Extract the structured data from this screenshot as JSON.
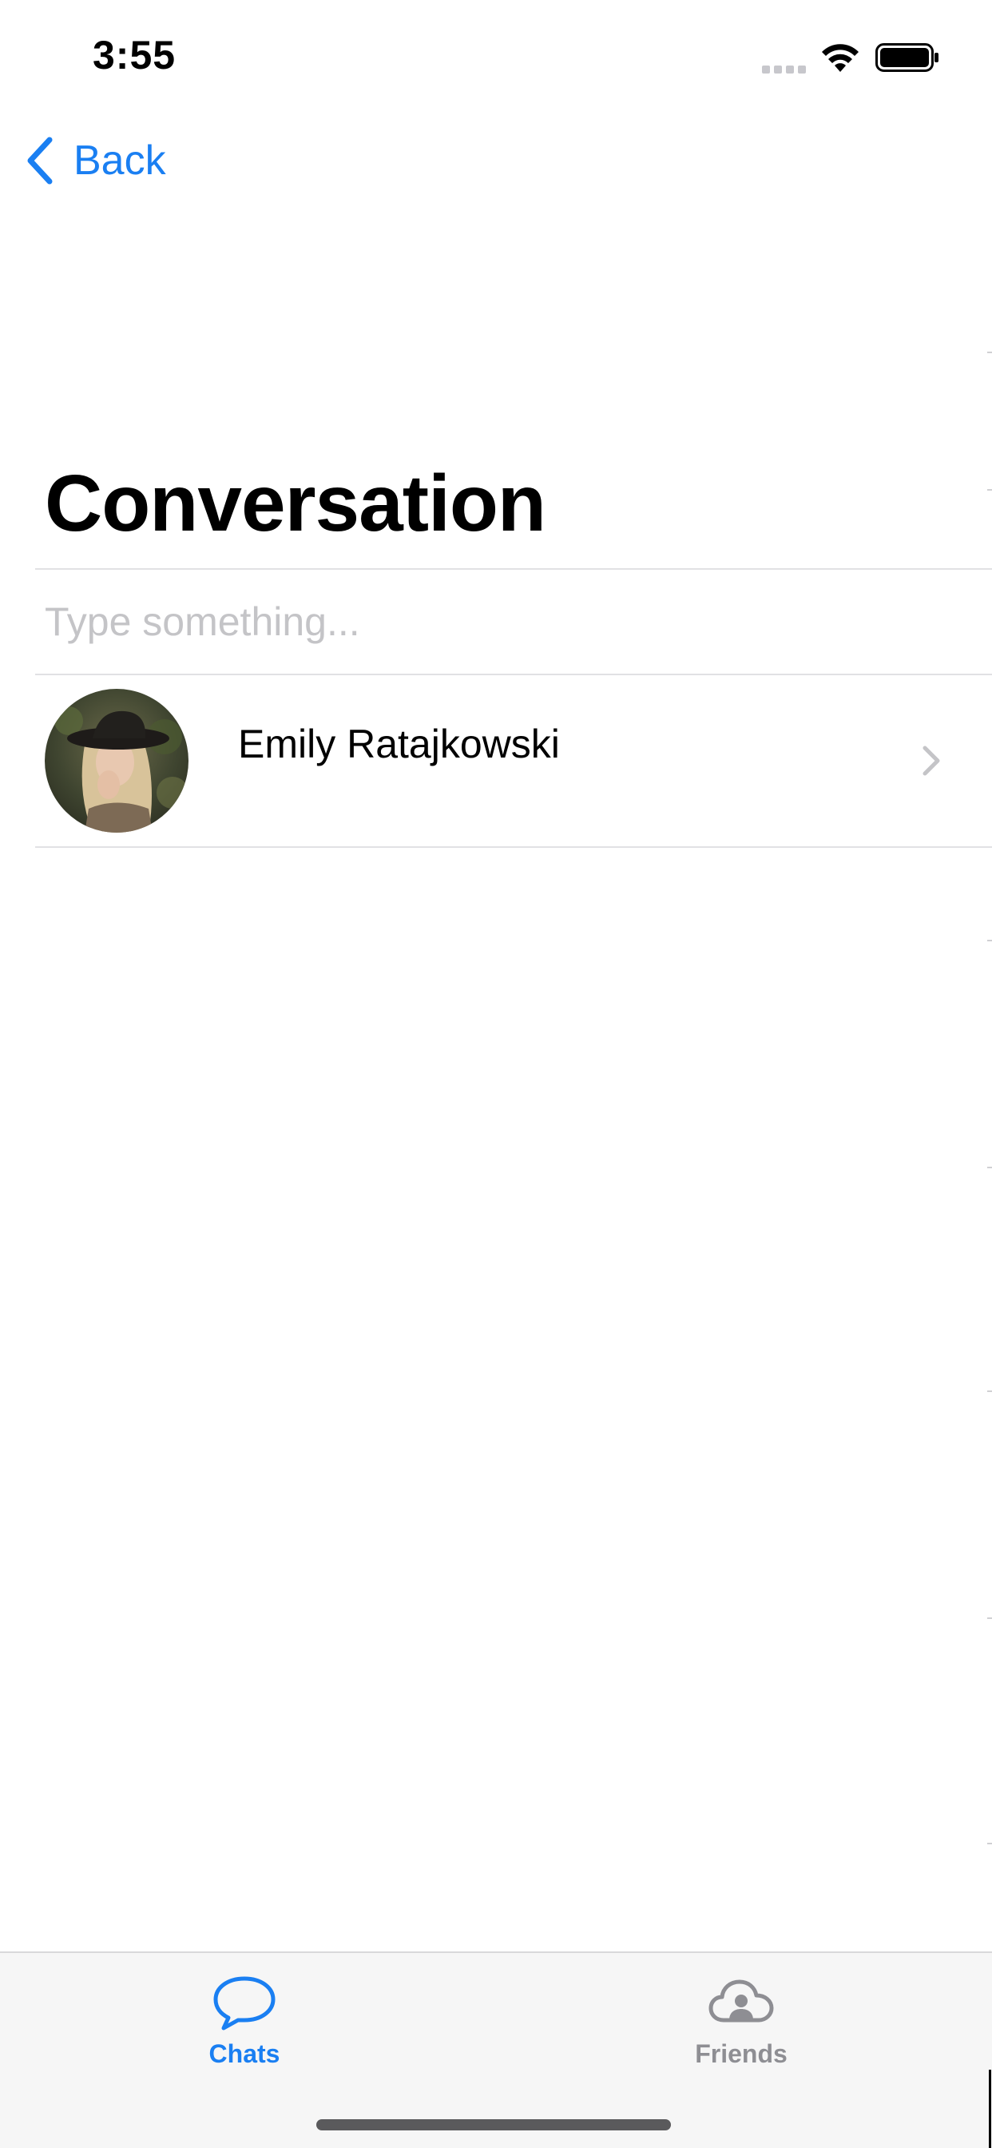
{
  "status_bar": {
    "time": "3:55"
  },
  "nav": {
    "back_label": "Back"
  },
  "page": {
    "title": "Conversation"
  },
  "search": {
    "placeholder": "Type something...",
    "value": ""
  },
  "conversations": [
    {
      "name": "Emily Ratajkowski",
      "avatar": "photo-avatar"
    }
  ],
  "tab_bar": {
    "tabs": [
      {
        "label": "Chats",
        "icon": "chat-bubble-icon",
        "selected": true
      },
      {
        "label": "Friends",
        "icon": "cloud-person-icon",
        "selected": false
      }
    ]
  },
  "colors": {
    "accent": "#1a7ff2",
    "inactive_tab": "#8e8e93",
    "placeholder": "#c4c4c7",
    "divider": "#e1e1e4",
    "tab_bar_bg": "#f6f6f6"
  }
}
